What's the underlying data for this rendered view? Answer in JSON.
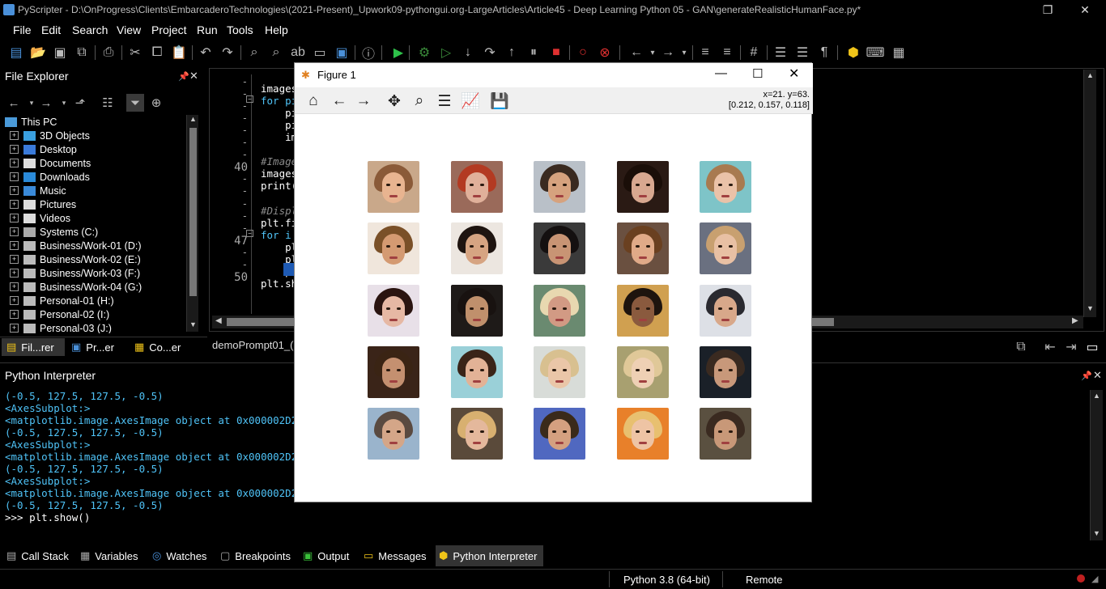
{
  "title": {
    "app": "PyScripter - D:\\OnProgress\\Clients\\EmbarcaderoTechnologies\\(2021-Present)_Upwork09-pythongui.org-LargeArticles\\Article45 - Deep Learning Python 05 - GAN\\generateRealisticHumanFace.py*"
  },
  "menu": [
    "File",
    "Edit",
    "Search",
    "View",
    "Project",
    "Run",
    "Tools",
    "Help"
  ],
  "explorer": {
    "title": "File Explorer",
    "root": "This PC",
    "items": [
      "3D Objects",
      "Desktop",
      "Documents",
      "Downloads",
      "Music",
      "Pictures",
      "Videos",
      "Systems (C:)",
      "Business/Work-01 (D:)",
      "Business/Work-02 (E:)",
      "Business/Work-03 (F:)",
      "Business/Work-04 (G:)",
      "Personal-01 (H:)",
      "Personal-02 (I:)",
      "Personal-03 (J:)"
    ],
    "tabs": [
      "Fil...rer",
      "Pr...er",
      "Co...er"
    ]
  },
  "editor": {
    "line_numbers": [
      "-",
      "-",
      "-",
      "-",
      "-",
      "-",
      "-",
      "40",
      "-",
      "-",
      "-",
      "-",
      "-",
      "47",
      "-",
      "-",
      "50"
    ],
    "code": [
      "images",
      "for pi",
      "    pi",
      "    pi",
      "    im",
      "",
      "#Image",
      "images",
      "print(",
      "",
      "#Displ",
      "plt.fi",
      "for i ",
      "    pl",
      "    pl",
      "    pl",
      "plt.sh"
    ],
    "tab": "demoPrompt01_("
  },
  "interpreter": {
    "title": "Python Interpreter",
    "lines": [
      "(-0.5, 127.5, 127.5, -0.5)",
      "<AxesSubplot:>",
      "<matplotlib.image.AxesImage object at 0x000002D2C0D",
      "(-0.5, 127.5, 127.5, -0.5)",
      "<AxesSubplot:>",
      "<matplotlib.image.AxesImage object at 0x000002D2C0D",
      "(-0.5, 127.5, 127.5, -0.5)",
      "<AxesSubplot:>",
      "<matplotlib.image.AxesImage object at 0x000002D2C0D",
      "(-0.5, 127.5, 127.5, -0.5)"
    ],
    "prompt": ">>> plt.show()"
  },
  "bottom_tabs": [
    "Call Stack",
    "Variables",
    "Watches",
    "Breakpoints",
    "Output",
    "Messages",
    "Python Interpreter"
  ],
  "status": {
    "python": "Python 3.8 (64-bit)",
    "engine": "Remote"
  },
  "figure": {
    "title": "Figure 1",
    "coord_line1": "x=21. y=63.",
    "coord_line2": "[0.212, 0.157, 0.118]",
    "faces": [
      {
        "bg": "#c9a88a",
        "hair": "#8a5a38",
        "skin": "#e8b490"
      },
      {
        "bg": "#9a6a5a",
        "hair": "#b33a22",
        "skin": "#e0b09a"
      },
      {
        "bg": "#b9c0c8",
        "hair": "#3a2a20",
        "skin": "#d6a27e"
      },
      {
        "bg": "#2a1a14",
        "hair": "#1a0e08",
        "skin": "#d8a890"
      },
      {
        "bg": "#7ec4c8",
        "hair": "#a87a50",
        "skin": "#eac2a8"
      },
      {
        "bg": "#f0e6dc",
        "hair": "#7a5028",
        "skin": "#d49a72"
      },
      {
        "bg": "#ece6e0",
        "hair": "#1e1410",
        "skin": "#d6a482"
      },
      {
        "bg": "#3a3a3a",
        "hair": "#141010",
        "skin": "#c89474"
      },
      {
        "bg": "#6a5040",
        "hair": "#6a4020",
        "skin": "#e0aa88"
      },
      {
        "bg": "#6a7080",
        "hair": "#c8a070",
        "skin": "#e8c0a4"
      },
      {
        "bg": "#e8e0e8",
        "hair": "#2a1410",
        "skin": "#e6b8a4"
      },
      {
        "bg": "#1e1a18",
        "hair": "#181210",
        "skin": "#c0906c"
      },
      {
        "bg": "#6a8a70",
        "hair": "#e8d8b0",
        "skin": "#d29a84"
      },
      {
        "bg": "#d0a050",
        "hair": "#1e140e",
        "skin": "#8a5a3e"
      },
      {
        "bg": "#dde0e6",
        "hair": "#2a2a30",
        "skin": "#d8a88a"
      },
      {
        "bg": "#3a2418",
        "hair": "#3a2414",
        "skin": "#c49070"
      },
      {
        "bg": "#9ad0d8",
        "hair": "#3a2418",
        "skin": "#e2b296"
      },
      {
        "bg": "#d8dcd8",
        "hair": "#d8c090",
        "skin": "#eac6a8"
      },
      {
        "bg": "#a8a070",
        "hair": "#e0c898",
        "skin": "#eed0b4"
      },
      {
        "bg": "#1a2028",
        "hair": "#3a2a20",
        "skin": "#c8987a"
      },
      {
        "bg": "#9ab4cc",
        "hair": "#5a4a40",
        "skin": "#d4a688"
      },
      {
        "bg": "#5a4a3a",
        "hair": "#d8b070",
        "skin": "#e4b89c"
      },
      {
        "bg": "#5068c0",
        "hair": "#3a2a1a",
        "skin": "#d4a080"
      },
      {
        "bg": "#e8802a",
        "hair": "#e8c070",
        "skin": "#eec4a4"
      },
      {
        "bg": "#5a5040",
        "hair": "#3a2a20",
        "skin": "#c89878"
      }
    ]
  }
}
